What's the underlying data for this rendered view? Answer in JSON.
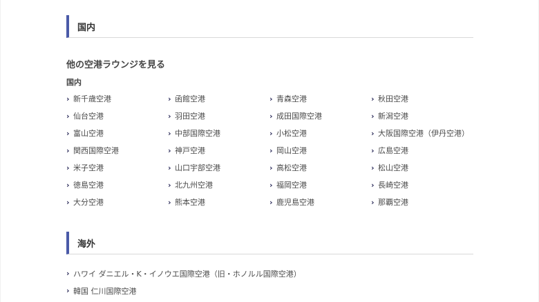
{
  "sections": {
    "domestic_title": "国内",
    "overseas_title": "海外"
  },
  "other_lounges": {
    "heading": "他の空港ラウンジを見る",
    "subheading": "国内"
  },
  "domestic_airports": [
    "新千歳空港",
    "函館空港",
    "青森空港",
    "秋田空港",
    "仙台空港",
    "羽田空港",
    "成田国際空港",
    "新潟空港",
    "富山空港",
    "中部国際空港",
    "小松空港",
    "大阪国際空港（伊丹空港）",
    "関西国際空港",
    "神戸空港",
    "岡山空港",
    "広島空港",
    "米子空港",
    "山口宇部空港",
    "高松空港",
    "松山空港",
    "徳島空港",
    "北九州空港",
    "福岡空港",
    "長崎空港",
    "大分空港",
    "熊本空港",
    "鹿児島空港",
    "那覇空港"
  ],
  "overseas_airports": [
    "ハワイ ダニエル・K・イノウエ国際空港（旧・ホノルル国際空港）",
    "韓国 仁川国際空港"
  ],
  "icons": {
    "link_chevron": "chevron-right-icon"
  },
  "colors": {
    "header_accent": "#4a5aa8",
    "chevron": "#2c2c5a"
  }
}
